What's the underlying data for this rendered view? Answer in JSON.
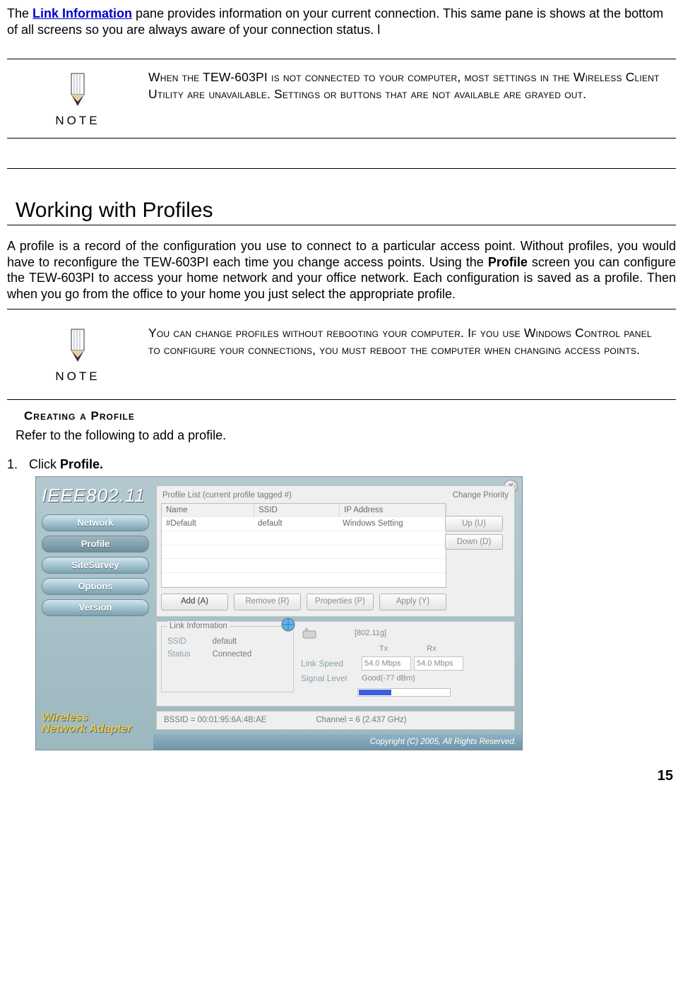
{
  "intro": {
    "prefix": "The ",
    "link_label": "Link Information",
    "rest": " pane provides information on your current connection. This same pane is shows at the bottom of all screens so you are always aware of your connection status. l"
  },
  "note1": {
    "label": "NOTE",
    "text": "When the TEW-603PI is not connected to your computer, most settings in the Wireless Client Utility are unavailable. Settings or buttons that are not available are grayed out."
  },
  "section_heading": "Working with Profiles",
  "para1_a": "A profile is a record of the configuration you use to connect to a particular access point. Without profiles, you would have to reconfigure the TEW-603PI each time you change access points. Using the ",
  "para1_bold": "Profile",
  "para1_b": " screen you can configure the TEW-603PI to access your home network and your office network. Each configuration is saved as a profile. Then when you go from the office to your home you just select the appropriate profile.",
  "note2": {
    "label": "NOTE",
    "text": "You can change profiles without rebooting your computer. If you use Windows Control panel to configure your connections, you must reboot the computer when changing access points."
  },
  "subheading": "Creating a Profile",
  "sub_intro": "Refer to the following to add a profile.",
  "step1_num": "1.",
  "step1_a": "Click ",
  "step1_bold": "Profile.",
  "app": {
    "logo": "IEEE802.11",
    "nav": [
      "Network",
      "Profile",
      "SiteSurvey",
      "Options",
      "Version"
    ],
    "wna_l1": "Wireless",
    "wna_l2": "Network Adapter",
    "hdr_left": "Profile List (current profile tagged #)",
    "hdr_right": "Change Priority",
    "cols": [
      "Name",
      "SSID",
      "IP Address"
    ],
    "row": [
      "#Default",
      "default",
      "Windows Setting"
    ],
    "up": "Up (U)",
    "down": "Down (D)",
    "add": "Add (A)",
    "remove": "Remove (R)",
    "props": "Properties (P)",
    "apply": "Apply (Y)",
    "link_info_legend": "Link Information",
    "ssid_lab": "SSID",
    "ssid_val": "default",
    "status_lab": "Status",
    "status_val": "Connected",
    "mode_tag": "[802.11g]",
    "tx_lab": "Tx",
    "rx_lab": "Rx",
    "linkspeed_lab": "Link Speed",
    "tx_val": "54.0 Mbps",
    "rx_val": "54.0 Mbps",
    "siglevel_lab": "Signal Level",
    "siglevel_val": "Good(-77 dBm)",
    "bssid": "BSSID = 00:01:95:6A:4B:AE",
    "channel": "Channel = 6 (2.437 GHz)",
    "copyright": "Copyright (C) 2005, All Rights Reserved."
  },
  "page_number": "15"
}
